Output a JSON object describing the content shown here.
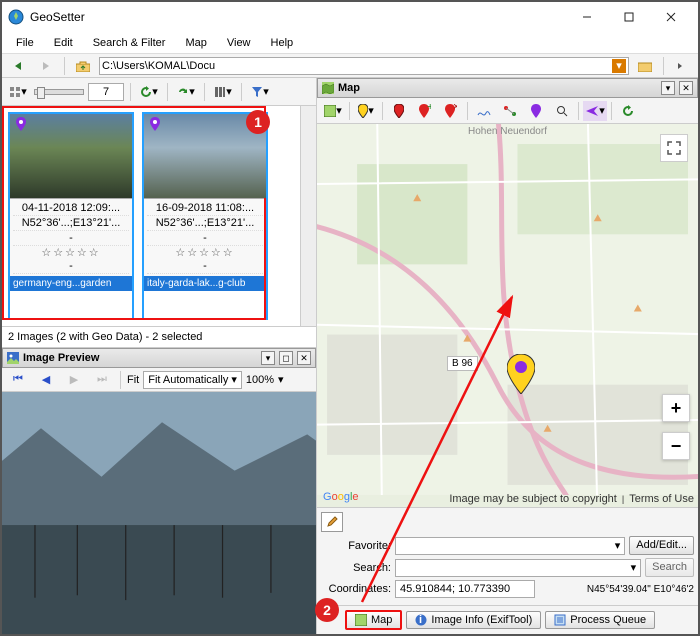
{
  "window": {
    "title": "GeoSetter"
  },
  "menu": [
    "File",
    "Edit",
    "Search & Filter",
    "Map",
    "View",
    "Help"
  ],
  "path": "C:\\Users\\KOMAL\\Docu",
  "spin": "7",
  "thumbs": [
    {
      "date": "04-11-2018 12:09:...",
      "coord": "N52°36'...;E13°21'...",
      "fname": "germany-eng...garden"
    },
    {
      "date": "16-09-2018 11:08:...",
      "coord": "N52°36'...;E13°21'...",
      "fname": "italy-garda-lak...g-club"
    }
  ],
  "status": "2 Images (2 with Geo Data) - 2 selected",
  "preview": {
    "title": "Image Preview",
    "fitlabel": "Fit",
    "fitmode": "Fit Automatically",
    "zoom": "100%"
  },
  "map": {
    "title": "Map",
    "toptext": "Hohen Neuendorf",
    "roadlabel": "B 96",
    "attribution": "Image may be subject to copyright",
    "terms": "Terms of Use",
    "google": "Google"
  },
  "controls": {
    "fav_label": "Favorite:",
    "addedit": "Add/Edit...",
    "search_label": "Search:",
    "searchbtn": "Search",
    "coord_label": "Coordinates:",
    "coord_val": "45.910844; 10.773390",
    "coord_dms": "N45°54'39.04\" E10°46'2"
  },
  "tabs": {
    "map": "Map",
    "info": "Image Info (ExifTool)",
    "queue": "Process Queue"
  },
  "ann": {
    "one": "1",
    "two": "2"
  }
}
